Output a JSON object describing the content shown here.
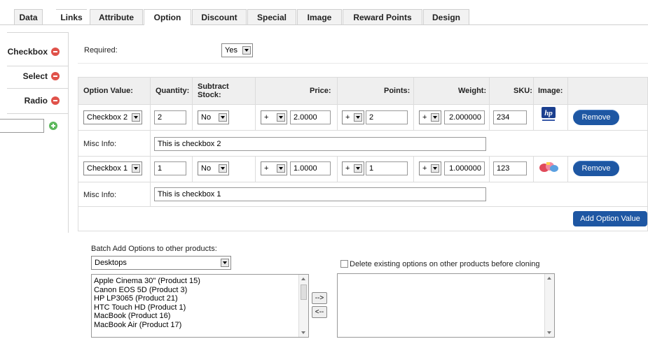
{
  "tabs": [
    {
      "label": "Data",
      "active": false
    },
    {
      "label": "Links",
      "active": false
    },
    {
      "label": "Attribute",
      "active": false
    },
    {
      "label": "Option",
      "active": true
    },
    {
      "label": "Discount",
      "active": false
    },
    {
      "label": "Special",
      "active": false
    },
    {
      "label": "Image",
      "active": false
    },
    {
      "label": "Reward Points",
      "active": false
    },
    {
      "label": "Design",
      "active": false
    }
  ],
  "option_list": [
    {
      "label": "Checkbox"
    },
    {
      "label": "Select"
    },
    {
      "label": "Radio"
    }
  ],
  "option_add_input": "",
  "required": {
    "label": "Required:",
    "value": "Yes"
  },
  "table": {
    "headers": {
      "option_value": "Option Value:",
      "quantity": "Quantity:",
      "subtract_stock": "Subtract Stock:",
      "price": "Price:",
      "points": "Points:",
      "weight": "Weight:",
      "sku": "SKU:",
      "image": "Image:"
    },
    "rows": [
      {
        "option_value": "Checkbox 2",
        "quantity": "2",
        "subtract": "No",
        "price_prefix": "+",
        "price": "2.0000",
        "points_prefix": "+",
        "points": "2",
        "weight_prefix": "+",
        "weight": "2.000000",
        "sku": "234",
        "image_icon": "hp-logo-image",
        "remove_label": "Remove",
        "misc_label": "Misc Info:",
        "misc_value": "This is checkbox 2"
      },
      {
        "option_value": "Checkbox 1",
        "quantity": "1",
        "subtract": "No",
        "price_prefix": "+",
        "price": "1.0000",
        "points_prefix": "+",
        "points": "1",
        "weight_prefix": "+",
        "weight": "1.000000",
        "sku": "123",
        "image_icon": "product-thumbnail-image",
        "remove_label": "Remove",
        "misc_label": "Misc Info:",
        "misc_value": "This is checkbox 1"
      }
    ],
    "add_label": "Add Option Value"
  },
  "batch": {
    "label": "Batch Add Options to other products:",
    "category": "Desktops",
    "products": [
      "Apple Cinema 30\" (Product 15)",
      "Canon EOS 5D (Product 3)",
      "HP LP3065 (Product 21)",
      "HTC Touch HD (Product 1)",
      "MacBook (Product 16)",
      "MacBook Air (Product 17)"
    ],
    "move_right": "-->",
    "move_left": "<--",
    "delete_label": "Delete existing options on other products before cloning"
  },
  "colors": {
    "accent": "#1e57a3",
    "remove_icon": "#e0524a",
    "add_icon": "#5cb85c"
  }
}
